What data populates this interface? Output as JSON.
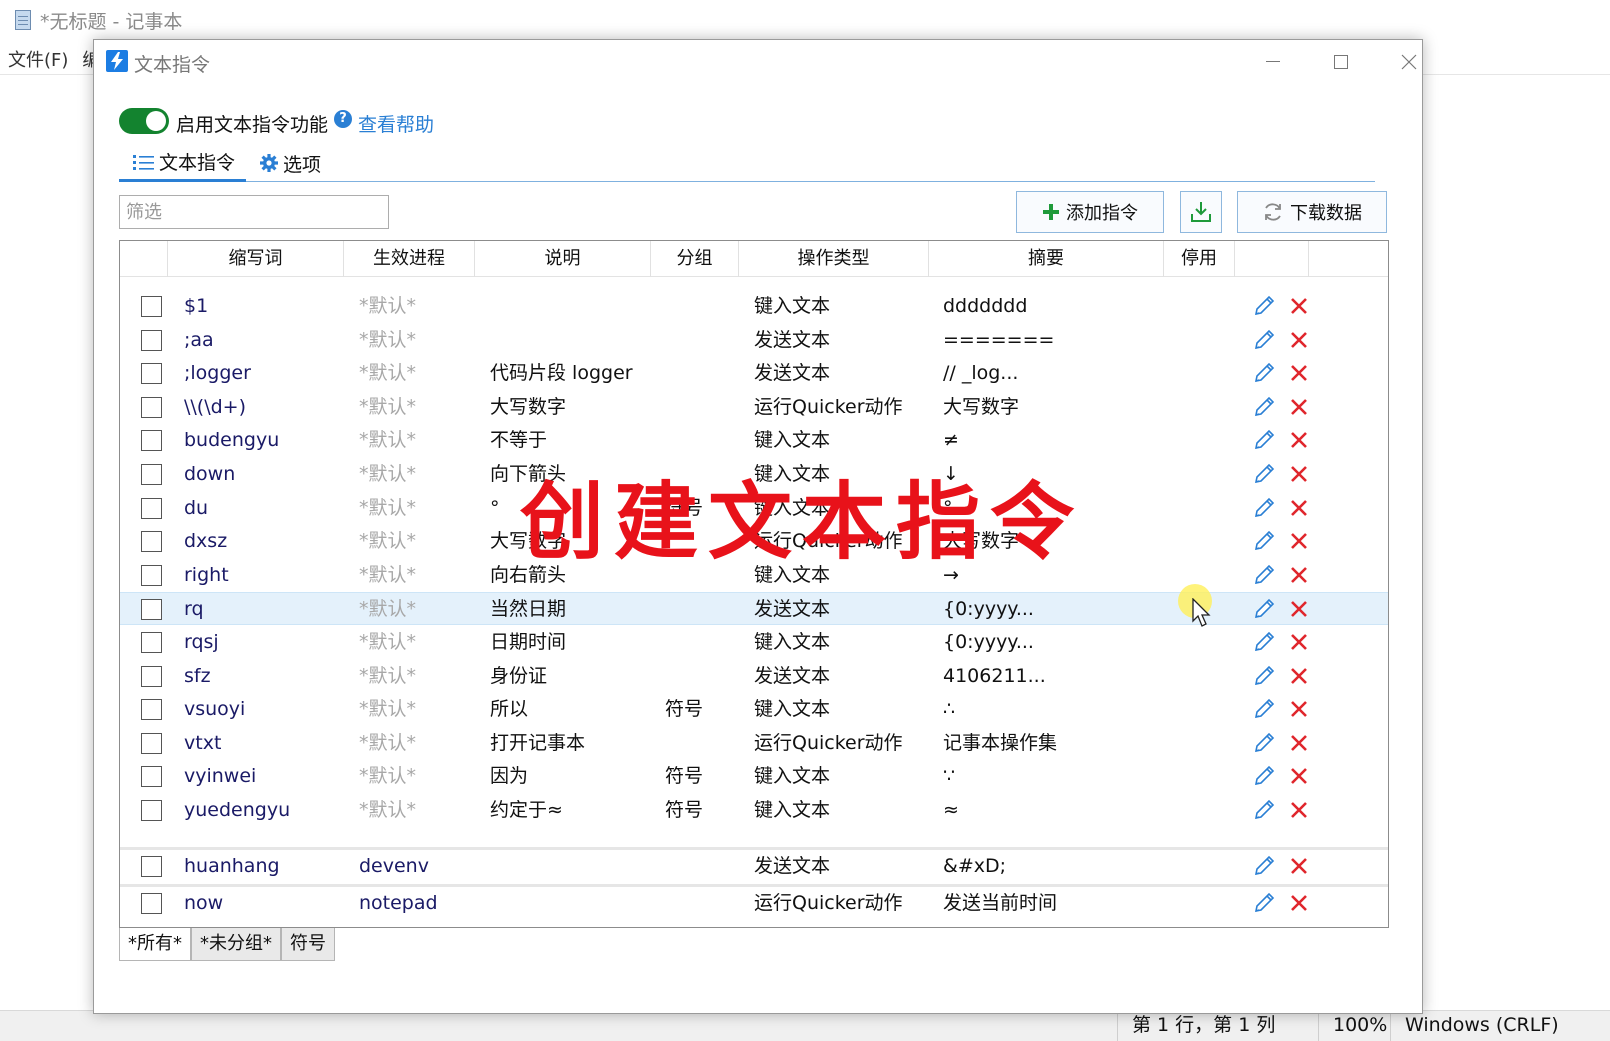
{
  "notepad": {
    "title": "*无标题 - 记事本",
    "menu": [
      "文件(F)",
      "编"
    ],
    "status": {
      "position": "第 1 行，第 1 列",
      "zoom": "100%",
      "eol": "Windows (CRLF)"
    }
  },
  "dialog": {
    "title": "文本指令",
    "toggle_label": "启用文本指令功能",
    "toggle_on": true,
    "help_link": "查看帮助",
    "tabs": {
      "commands": "文本指令",
      "options": "选项"
    },
    "filter_placeholder": "筛选",
    "buttons": {
      "add": "添加指令",
      "download": "下载数据"
    },
    "table": {
      "columns": [
        "缩写词",
        "生效进程",
        "说明",
        "分组",
        "操作类型",
        "摘要",
        "停用"
      ],
      "rows": [
        {
          "abbr": "$1",
          "process": "*默认*",
          "desc": "",
          "group": "",
          "action": "键入文本",
          "summary": "ddddddd"
        },
        {
          "abbr": ";aa",
          "process": "*默认*",
          "desc": "",
          "group": "",
          "action": "发送文本",
          "summary": "======="
        },
        {
          "abbr": ";logger",
          "process": "*默认*",
          "desc": "代码片段 logger",
          "group": "",
          "action": "发送文本",
          "summary": "// _log..."
        },
        {
          "abbr": "\\\\(\\d+)",
          "process": "*默认*",
          "desc": "大写数字",
          "group": "",
          "action": "运行Quicker动作",
          "summary": "大写数字"
        },
        {
          "abbr": "budengyu",
          "process": "*默认*",
          "desc": "不等于",
          "group": "",
          "action": "键入文本",
          "summary": "≠"
        },
        {
          "abbr": "down",
          "process": "*默认*",
          "desc": "向下箭头",
          "group": "",
          "action": "键入文本",
          "summary": "↓"
        },
        {
          "abbr": "du",
          "process": "*默认*",
          "desc": "°",
          "group": "符号",
          "action": "键入文本",
          "summary": "°"
        },
        {
          "abbr": "dxsz",
          "process": "*默认*",
          "desc": "大写数字",
          "group": "",
          "action": "运行Quicker动作",
          "summary": "大写数字"
        },
        {
          "abbr": "right",
          "process": "*默认*",
          "desc": "向右箭头",
          "group": "",
          "action": "键入文本",
          "summary": "→"
        },
        {
          "abbr": "rq",
          "process": "*默认*",
          "desc": "当然日期",
          "group": "",
          "action": "发送文本",
          "summary": "{0:yyyy..."
        },
        {
          "abbr": "rqsj",
          "process": "*默认*",
          "desc": "日期时间",
          "group": "",
          "action": "键入文本",
          "summary": "{0:yyyy..."
        },
        {
          "abbr": "sfz",
          "process": "*默认*",
          "desc": "身份证",
          "group": "",
          "action": "发送文本",
          "summary": "4106211..."
        },
        {
          "abbr": "vsuoyi",
          "process": "*默认*",
          "desc": "所以",
          "group": "符号",
          "action": "键入文本",
          "summary": "∴"
        },
        {
          "abbr": "vtxt",
          "process": "*默认*",
          "desc": "打开记事本",
          "group": "",
          "action": "运行Quicker动作",
          "summary": "记事本操作集"
        },
        {
          "abbr": "vyinwei",
          "process": "*默认*",
          "desc": "因为",
          "group": "符号",
          "action": "键入文本",
          "summary": "∵"
        },
        {
          "abbr": "yuedengyu",
          "process": "*默认*",
          "desc": "约定于≈",
          "group": "符号",
          "action": "键入文本",
          "summary": "≈"
        },
        {
          "abbr": "huanhang",
          "process": "devenv",
          "desc": "",
          "group": "",
          "action": "发送文本",
          "summary": "&#xD;"
        },
        {
          "abbr": "now",
          "process": "notepad",
          "desc": "",
          "group": "",
          "action": "运行Quicker动作",
          "summary": "发送当前时间"
        }
      ],
      "selected_row": "rq"
    },
    "bottom_tabs": [
      "*所有*",
      "*未分组*",
      "符号"
    ],
    "active_bottom_tab": "*所有*"
  },
  "overlay_caption": "创建文本指令",
  "colors": {
    "accent": "#2a7fd4",
    "toggle_on": "#13832f",
    "delete": "#e0262c",
    "caption": "#e8121a"
  }
}
